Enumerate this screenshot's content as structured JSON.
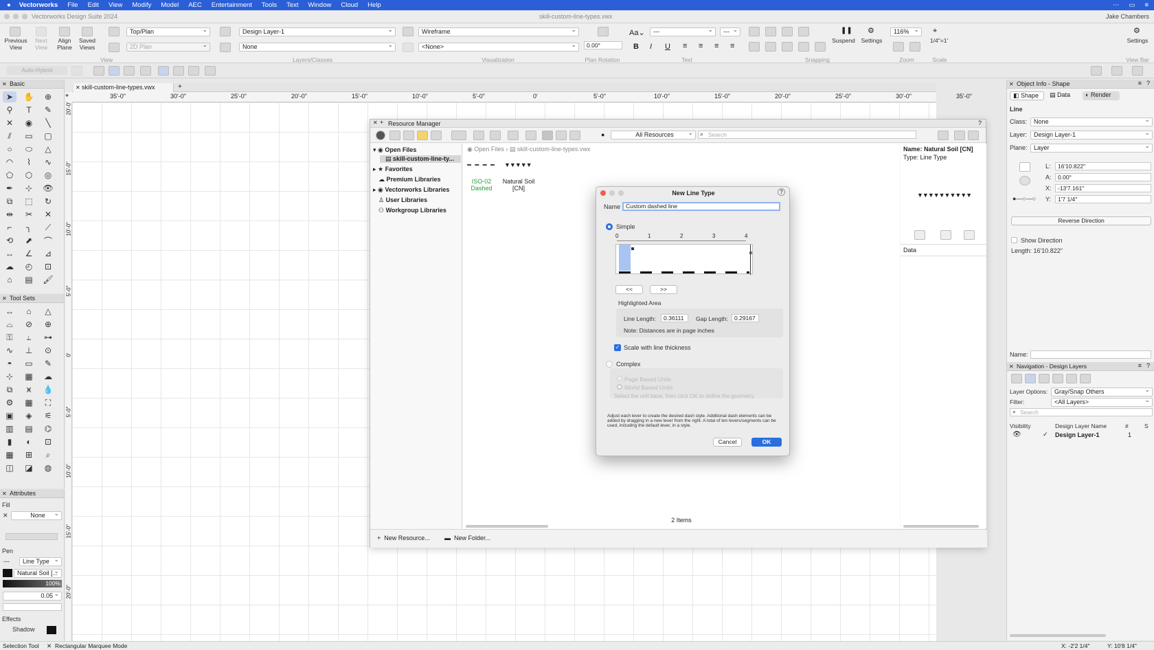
{
  "menubar": {
    "app": "Vectorworks",
    "items": [
      "File",
      "Edit",
      "View",
      "Modify",
      "Model",
      "AEC",
      "Entertainment",
      "Tools",
      "Text",
      "Window",
      "Cloud",
      "Help"
    ]
  },
  "window": {
    "app_title": "Vectorworks Design Suite 2024",
    "doc_title": "skill-custom-line-types.vwx",
    "user": "Jake Chambers"
  },
  "toolbar": {
    "previous_view": "Previous View",
    "next_view": "Next View",
    "align_plane": "Align Plane",
    "saved_views": "Saved Views",
    "view_dd": "Top/Plan",
    "plan_dd": "2D Plan",
    "layer_dd": "Design Layer-1",
    "class_dd": "None",
    "render_dd": "Wireframe",
    "none_dd": "<None>",
    "rotation": "0.00°",
    "font_dd": "---",
    "size_dd": "---",
    "suspend": "Suspend",
    "settings": "Settings",
    "zoom": "116%",
    "scale": "1/4\"=1'",
    "settings_right": "Settings",
    "view_bar": "View Bar",
    "groups": {
      "view": "View",
      "layers": "Layers/Classes",
      "vis": "Visualization",
      "rot": "Plan Rotation",
      "text": "Text",
      "snap": "Snapping",
      "zoom": "Zoom",
      "scale": "Scale"
    },
    "autohybrid": "Auto-Hybrid"
  },
  "palettes": {
    "basic": "Basic",
    "toolsets": "Tool Sets",
    "attributes": "Attributes",
    "fill": "Fill",
    "fill_value": "None",
    "pen": "Pen",
    "line_type": "Line Type",
    "pen_value": "Natural Soil [...",
    "opacity": "100%",
    "thickness": "0.05",
    "effects": "Effects",
    "shadow": "Shadow"
  },
  "doc_tab": "skill-custom-line-types.vwx",
  "ruler_labels": [
    "35'-0\"",
    "30'-0\"",
    "25'-0\"",
    "20'-0\"",
    "15'-0\"",
    "10'-0\"",
    "5'-0\"",
    "0'",
    "5'-0\"",
    "10'-0\"",
    "15'-0\"",
    "20'-0\"",
    "25'-0\"",
    "30'-0\"",
    "35'-0\""
  ],
  "vruler_labels": [
    "20'-0\"",
    "15'-0\"",
    "10'-0\"",
    "5'-0\"",
    "0'",
    "5'-0\"",
    "10'-0\"",
    "15'-0\"",
    "20'-0\""
  ],
  "resource_manager": {
    "title": "Resource Manager",
    "filter": "All Resources",
    "search_placeholder": "Search",
    "tree": [
      "Open Files",
      "skill-custom-line-ty...",
      "Favorites",
      "Premium Libraries",
      "Vectorworks Libraries",
      "User Libraries",
      "Workgroup Libraries"
    ],
    "breadcrumb": [
      "Open Files",
      "skill-custom-line-types.vwx"
    ],
    "items": [
      {
        "name": "ISO-02 Dashed"
      },
      {
        "name": "Natural Soil [CN]"
      }
    ],
    "count": "2 Items",
    "preview_name": "Name: Natural Soil [CN]",
    "preview_type": "Type: Line Type",
    "data_label": "Data",
    "new_resource": "New Resource...",
    "new_folder": "New Folder..."
  },
  "dialog": {
    "title": "New Line Type",
    "name_label": "Name",
    "name_value": "Custom  dashed line",
    "simple": "Simple",
    "ruler": [
      "0",
      "1",
      "2",
      "3",
      "4"
    ],
    "prev": "<<",
    "next": ">>",
    "highlighted": "Highlighted Area",
    "line_length_label": "Line Length:",
    "line_length": "0.36111",
    "gap_length_label": "Gap Length:",
    "gap_length": "0.29167",
    "note": "Note: Distances are in page inches",
    "scale_check": "Scale with line thickness",
    "complex": "Complex",
    "page_units": "Page Based Units",
    "world_units": "World Based Units",
    "complex_hint": "Select the unit base, then click OK to define the geometry.",
    "help": "Adjust each lever to create the desired dash style. Additional dash elements can be added by dragging in a new lever from the right. A total of ten levers/segments can be used, including the default lever, in a style.",
    "cancel": "Cancel",
    "ok": "OK"
  },
  "object_info": {
    "title": "Object Info - Shape",
    "tabs": [
      "Shape",
      "Data",
      "Render"
    ],
    "type": "Line",
    "class_label": "Class:",
    "class_value": "None",
    "layer_label": "Layer:",
    "layer_value": "Design Layer-1",
    "plane_label": "Plane:",
    "plane_value": "Layer",
    "L_label": "L:",
    "L": "16'10.822\"",
    "A_label": "A:",
    "A": "0.00°",
    "X_label": "X:",
    "X": "-13'7.161\"",
    "Y_label": "Y:",
    "Y": "1'7 1/4\"",
    "reverse": "Reverse Direction",
    "show_direction": "Show Direction",
    "length": "Length:  16'10.822\"",
    "name_label": "Name:"
  },
  "navigation": {
    "title": "Navigation - Design Layers",
    "layer_options_label": "Layer Options:",
    "layer_options": "Gray/Snap Others",
    "filter_label": "Filter:",
    "filter": "<All Layers>",
    "search_placeholder": "Search",
    "cols": [
      "Visibility",
      "Design Layer Name",
      "#",
      "S"
    ],
    "row": {
      "name": "Design Layer-1",
      "num": "1"
    }
  },
  "status": {
    "tool": "Selection Tool",
    "mode": "Rectangular Marquee Mode",
    "x": "X: -2'2 1/4\"",
    "y": "Y: 10'8 1/4\""
  }
}
